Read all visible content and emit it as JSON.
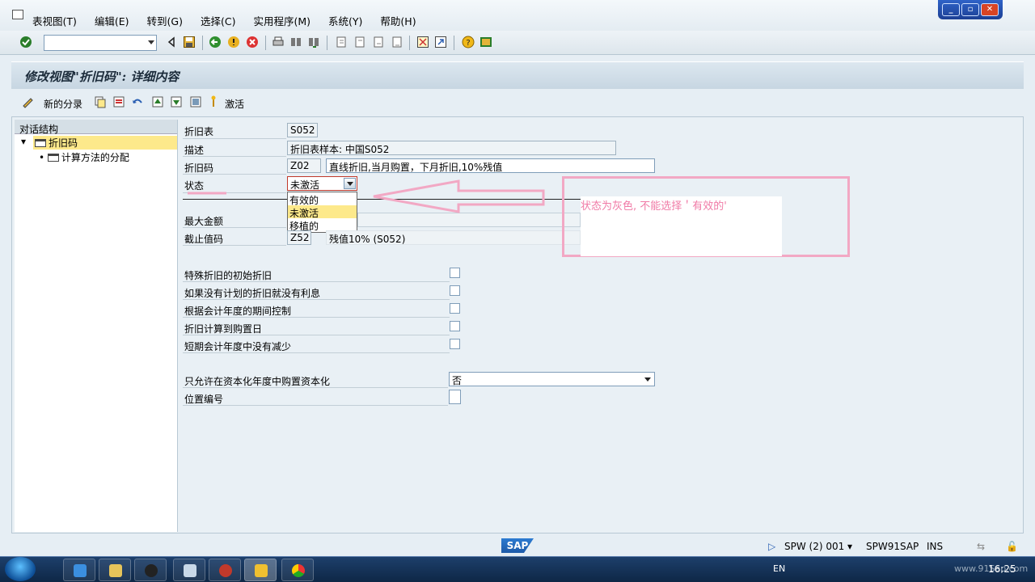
{
  "menubar": {
    "items": [
      "表视图(T)",
      "编辑(E)",
      "转到(G)",
      "选择(C)",
      "实用程序(M)",
      "系统(Y)",
      "帮助(H)"
    ]
  },
  "window_controls": [
    "minimize-icon",
    "restore-icon",
    "close-icon"
  ],
  "toolbar": {
    "command_field_value": "",
    "icons": [
      "enter-check-icon",
      "back-arrow-icon",
      "save-icon",
      "back-icon",
      "exit-icon",
      "cancel-icon",
      "print-icon",
      "find-icon",
      "find-next-icon",
      "first-page-icon",
      "prev-page-icon",
      "next-page-icon",
      "last-page-icon",
      "create-session-icon",
      "shortcut-icon",
      "help-icon",
      "layout-icon"
    ]
  },
  "title": "修改视图\"折旧码\": 详细内容",
  "app_toolbar": {
    "new_entries_label": "新的分录",
    "activate_label": "激活",
    "icons": [
      "change-icon",
      "copy-icon",
      "delete-icon",
      "undo-icon",
      "previous-entry-icon",
      "next-entry-icon",
      "select-all-icon",
      "activate-icon"
    ]
  },
  "tree": {
    "header": "对话结构",
    "nodes": [
      {
        "label": "折旧码",
        "selected": true
      },
      {
        "label": "计算方法的分配",
        "selected": false
      }
    ]
  },
  "form": {
    "fields": [
      {
        "label": "折旧表",
        "value": "S052"
      },
      {
        "label": "描述",
        "value": "折旧表样本: 中国S052"
      },
      {
        "label": "折旧码",
        "value": "Z02",
        "description": "直线折旧,当月购置，下月折旧,10%残值"
      },
      {
        "label": "状态",
        "value": "未激活"
      },
      {
        "label": "最大金额",
        "value": ""
      },
      {
        "label": "截止值码",
        "value": "Z52",
        "description": "残值10% (S052)"
      }
    ],
    "checkboxes": [
      {
        "label": "特殊折旧的初始折旧",
        "checked": false
      },
      {
        "label": "如果没有计划的折旧就没有利息",
        "checked": false
      },
      {
        "label": "根据会计年度的期间控制",
        "checked": false
      },
      {
        "label": "折旧计算到购置日",
        "checked": false
      },
      {
        "label": "短期会计年度中没有减少",
        "checked": false
      }
    ],
    "capitalization": {
      "label": "只允许在资本化年度中购置资本化",
      "value": "否"
    },
    "position_number": {
      "label": "位置编号",
      "value": ""
    }
  },
  "dropdown": {
    "options": [
      "有效的",
      "未激活",
      "移植的"
    ],
    "selected": "未激活"
  },
  "annotation": {
    "text": "状态为灰色, 不能选择＇有效的'",
    "color": "#f07aa6"
  },
  "statusbar": {
    "logo": "SAP",
    "system": "SPW (2) 001",
    "server": "SPW91SAP",
    "mode": "INS"
  },
  "taskbar": {
    "language": "EN",
    "clock": "16:25",
    "watermark": "www.91Sap.com"
  }
}
